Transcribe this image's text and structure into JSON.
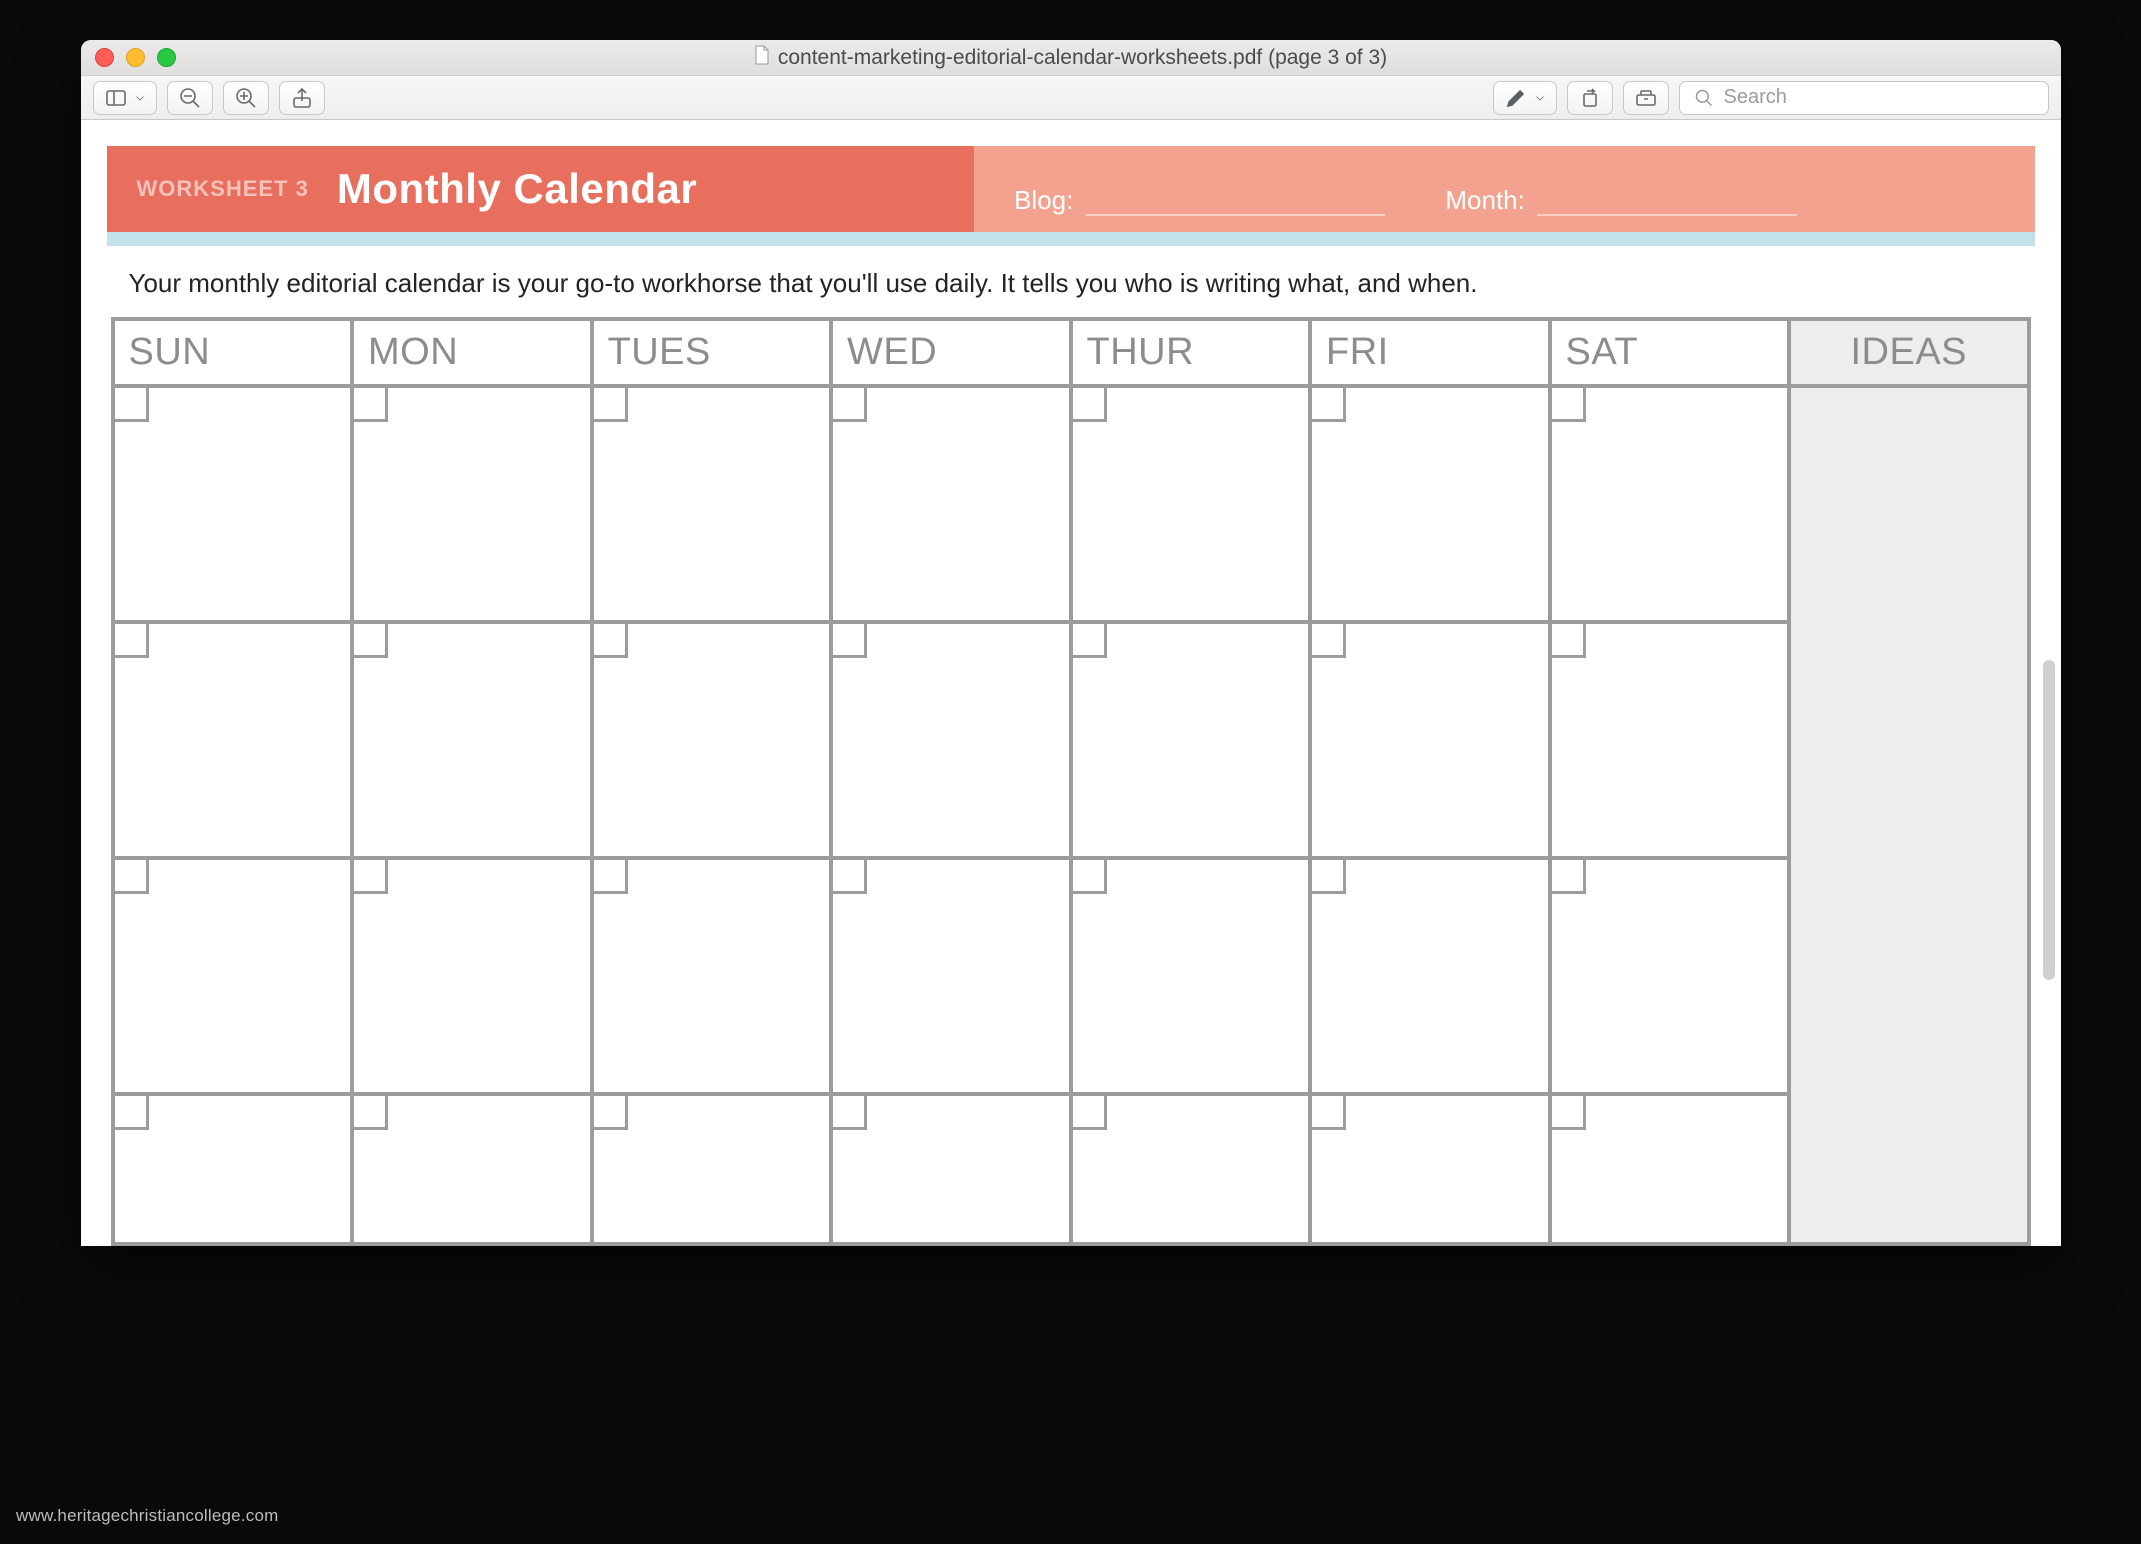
{
  "window": {
    "title": "content-marketing-editorial-calendar-worksheets.pdf (page 3 of 3)"
  },
  "toolbar": {
    "search_placeholder": "Search"
  },
  "worksheet": {
    "number_label": "WORKSHEET 3",
    "title": "Monthly Calendar",
    "blog_label": "Blog:",
    "month_label": "Month:",
    "intro": "Your monthly editorial calendar is your go-to workhorse that you'll use daily. It tells you who is writing what, and when.",
    "days": [
      "SUN",
      "MON",
      "TUES",
      "WED",
      "THUR",
      "FRI",
      "SAT"
    ],
    "ideas_label": "IDEAS"
  },
  "watermark": "www.heritagechristiancollege.com"
}
